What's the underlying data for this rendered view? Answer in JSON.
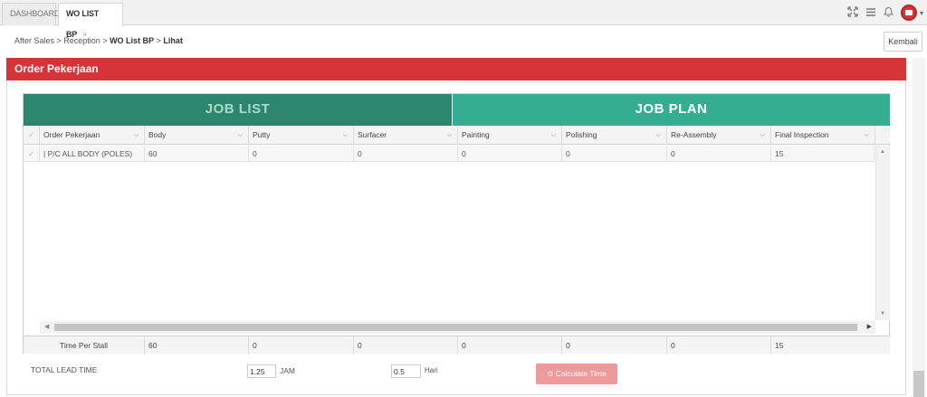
{
  "tabs": [
    {
      "label": "DASHBOARD"
    },
    {
      "label": "WO LIST BP",
      "close": "×"
    }
  ],
  "header_icons": [
    "fullscreen-icon",
    "menu-icon",
    "bell-icon",
    "avatar",
    "chevron-down-icon"
  ],
  "breadcrumb": {
    "path": "After Sales > Reception > ",
    "current": "WO List BP",
    "sep": " > ",
    "last": "Lihat"
  },
  "back_button": "Kembali",
  "panel": {
    "title": "Order Pekerjaan"
  },
  "grid": {
    "job_list_header": "JOB LIST",
    "job_plan_header": "JOB PLAN",
    "columns": [
      "Order Pekerjaan",
      "Body",
      "Putty",
      "Surfacer",
      "Painting",
      "Polishing",
      "Re-Assembly",
      "Final Inspection"
    ],
    "rows": [
      {
        "cells": [
          "| P/C ALL BODY (POLES)",
          "60",
          "0",
          "0",
          "0",
          "0",
          "0",
          "15"
        ]
      }
    ],
    "footer": {
      "label": "Time Per Stall",
      "values": [
        "60",
        "0",
        "0",
        "0",
        "0",
        "0",
        "15"
      ]
    }
  },
  "lead_time": {
    "label": "TOTAL LEAD TIME",
    "jam_value": "1.25",
    "jam_unit": "JAM",
    "hari_value": "0.5",
    "hari_unit": "Hari",
    "calc_button": "Calculate Time"
  },
  "colors": {
    "panel_red": "#d63339",
    "job_list": "#2d856d",
    "job_plan": "#34ad91",
    "calc_button": "#ee9a9a"
  }
}
